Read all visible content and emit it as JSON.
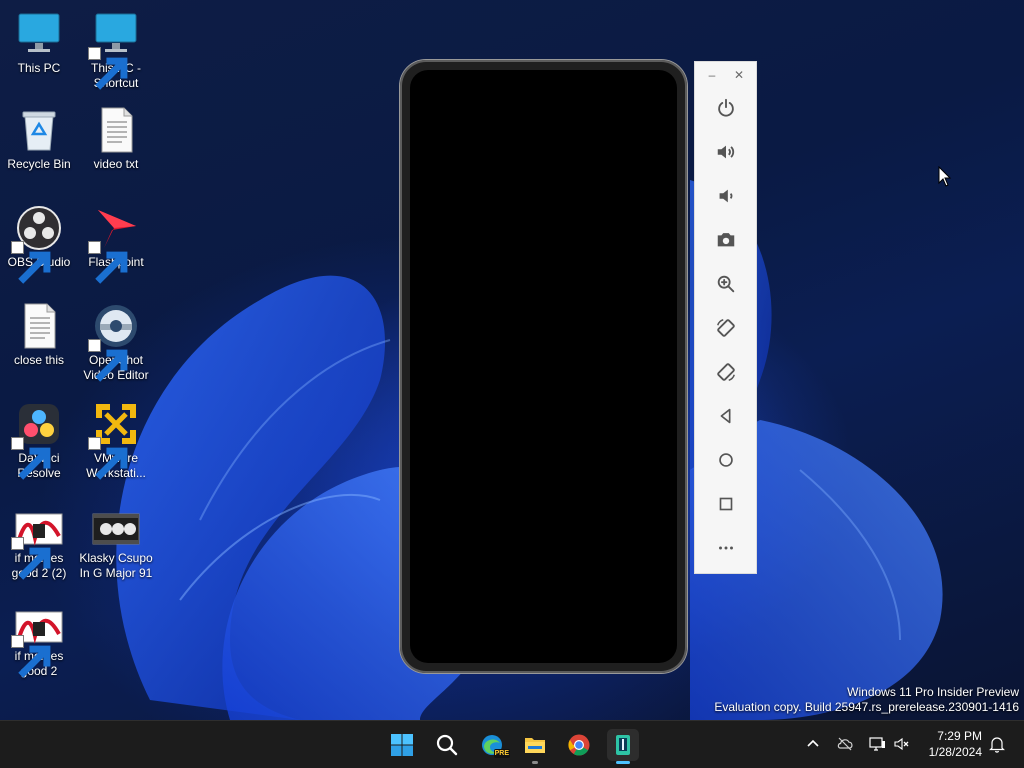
{
  "desktop": {
    "icons": [
      {
        "label": "This PC"
      },
      {
        "label": "This PC -\nShortcut"
      },
      {
        "label": "Recycle Bin"
      },
      {
        "label": "video txt"
      },
      {
        "label": "OBS Studio"
      },
      {
        "label": "Flashpoint"
      },
      {
        "label": "close this"
      },
      {
        "label": "OpenShot\nVideo Editor"
      },
      {
        "label": "DaVinci\nResolve"
      },
      {
        "label": "VMware\nWorkstati..."
      },
      {
        "label": "if memes\ngood 2 (2)"
      },
      {
        "label": "Klasky Csupo\nIn G Major 91"
      },
      {
        "label": "if memes\ngood 2"
      }
    ],
    "watermark": {
      "line1": "Windows 11 Pro Insider Preview",
      "line2": "Evaluation copy. Build 25947.rs_prerelease.230901-1416"
    }
  },
  "toolbar": {
    "minimize": "–",
    "close": "✕",
    "buttons": [
      {
        "icon": "power-icon"
      },
      {
        "icon": "volume-up-icon"
      },
      {
        "icon": "volume-down-icon"
      },
      {
        "icon": "camera-icon"
      },
      {
        "icon": "zoom-icon"
      },
      {
        "icon": "rotate-left-icon"
      },
      {
        "icon": "rotate-right-icon"
      },
      {
        "icon": "back-icon"
      },
      {
        "icon": "home-icon"
      },
      {
        "icon": "overview-icon"
      },
      {
        "icon": "more-icon"
      }
    ]
  },
  "taskbar": {
    "pre_badge": "PRE",
    "clock": {
      "time": "7:29 PM",
      "date": "1/28/2024"
    },
    "accent": "#4cc2ff"
  }
}
